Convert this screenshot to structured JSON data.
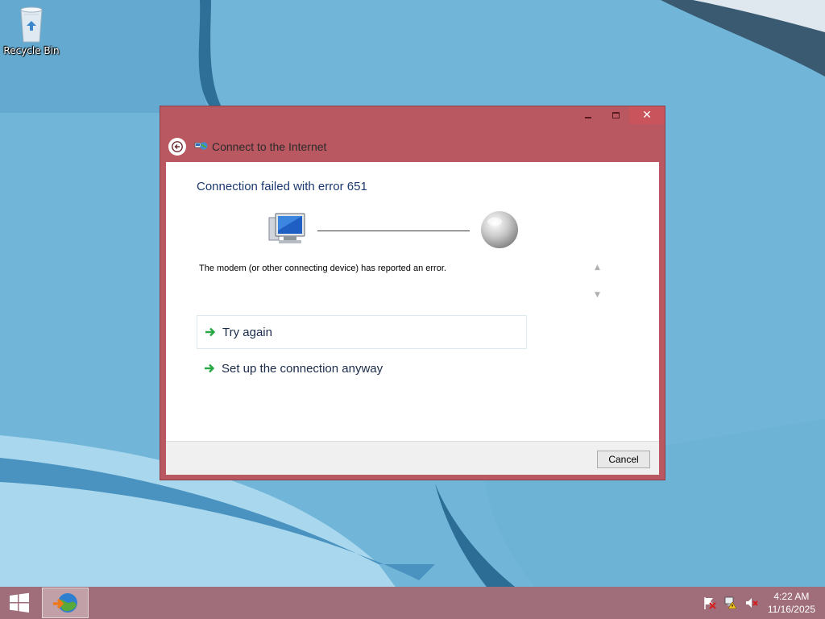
{
  "desktop": {
    "icons": [
      {
        "label": "Recycle Bin",
        "icon": "recycle-bin-icon"
      }
    ]
  },
  "window": {
    "title": "Connect to the Internet",
    "controls": {
      "minimize": "minimize",
      "maximize": "maximize",
      "close": "✕"
    },
    "heading": "Connection failed with error 651",
    "message": "The modem (or other connecting device) has reported an error.",
    "links": [
      {
        "label": "Try again",
        "icon": "green-arrow-icon"
      },
      {
        "label": "Set up the connection anyway",
        "icon": "green-arrow-icon"
      }
    ],
    "cancel_label": "Cancel",
    "accent_color": "#b95860"
  },
  "taskbar": {
    "items": [
      {
        "icon": "network-globe-icon"
      }
    ],
    "tray": [
      "action-center-flag-icon",
      "network-warning-icon",
      "volume-muted-icon"
    ],
    "time": "4:22 AM",
    "date": "11/16/2025"
  }
}
